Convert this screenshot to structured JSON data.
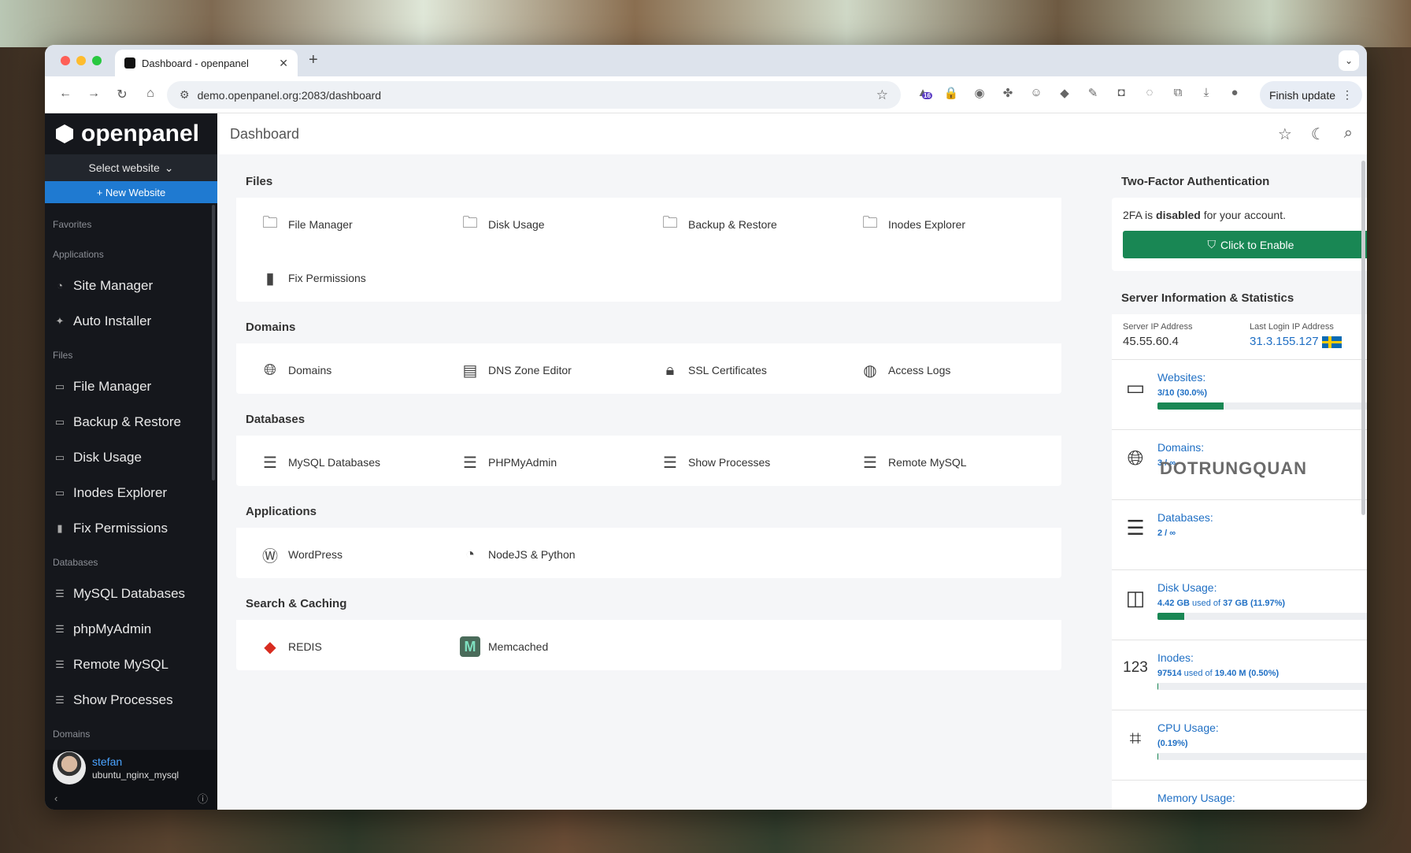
{
  "browser": {
    "tab_title": "Dashboard - openpanel",
    "url": "demo.openpanel.org:2083/dashboard",
    "finish_update": "Finish update",
    "ext_badge": "16"
  },
  "sidebar": {
    "brand": "openpanel",
    "select_website": "Select website",
    "new_website": "+ New Website",
    "groups": {
      "favorites": "Favorites",
      "applications": "Applications",
      "files": "Files",
      "databases": "Databases",
      "domains": "Domains"
    },
    "items": [
      {
        "label": "Site Manager",
        "icon": "site-manager-icon"
      },
      {
        "label": "Auto Installer",
        "icon": "sparkle-icon"
      },
      {
        "label": "File Manager",
        "icon": "folder-icon"
      },
      {
        "label": "Backup & Restore",
        "icon": "folder-icon"
      },
      {
        "label": "Disk Usage",
        "icon": "folder-icon"
      },
      {
        "label": "Inodes Explorer",
        "icon": "folder-icon"
      },
      {
        "label": "Fix Permissions",
        "icon": "file-icon"
      },
      {
        "label": "MySQL Databases",
        "icon": "database-icon"
      },
      {
        "label": "phpMyAdmin",
        "icon": "database-icon"
      },
      {
        "label": "Remote MySQL",
        "icon": "database-icon"
      },
      {
        "label": "Show Processes",
        "icon": "database-icon"
      }
    ],
    "user": {
      "name": "stefan",
      "plan": "ubuntu_nginx_mysql"
    }
  },
  "topbar": {
    "title": "Dashboard"
  },
  "sections": {
    "files": {
      "title": "Files",
      "items": [
        "File Manager",
        "Disk Usage",
        "Backup & Restore",
        "Inodes Explorer",
        "Fix Permissions"
      ]
    },
    "domains": {
      "title": "Domains",
      "items": [
        "Domains",
        "DNS Zone Editor",
        "SSL Certificates",
        "Access Logs"
      ]
    },
    "databases": {
      "title": "Databases",
      "items": [
        "MySQL Databases",
        "PHPMyAdmin",
        "Show Processes",
        "Remote MySQL"
      ]
    },
    "applications": {
      "title": "Applications",
      "items": [
        "WordPress",
        "NodeJS & Python"
      ]
    },
    "caching": {
      "title": "Search & Caching",
      "items": [
        "REDIS",
        "Memcached"
      ]
    }
  },
  "tfa": {
    "title": "Two-Factor Authentication",
    "text_prefix": "2FA is ",
    "text_strong": "disabled",
    "text_suffix": " for your account.",
    "button": "Click to Enable"
  },
  "server": {
    "title": "Server Information & Statistics",
    "ip_label": "Server IP Address",
    "ip_value": "45.55.60.4",
    "login_label": "Last Login IP Address",
    "login_value": "31.3.155.127",
    "stats": [
      {
        "title": "Websites:",
        "value": "3/10 (30.0%)",
        "progress": 0.3
      },
      {
        "title": "Domains:",
        "value": "3 / ∞"
      },
      {
        "title": "Databases:",
        "value": "2 / ∞"
      },
      {
        "title": "Disk Usage:",
        "value_a": "4.42 GB",
        "value_mid": " used of ",
        "value_b": "37 GB (11.97%)",
        "progress": 0.1197
      },
      {
        "title": "Inodes:",
        "value_a": "97514",
        "value_mid": " used of ",
        "value_b": "19.40 M (0.50%)",
        "progress": 0.005
      },
      {
        "title": "CPU Usage:",
        "value": "(0.19%)",
        "progress": 0.0019
      },
      {
        "title": "Memory Usage:"
      }
    ]
  },
  "watermark": "DOTRUNGQUAN"
}
